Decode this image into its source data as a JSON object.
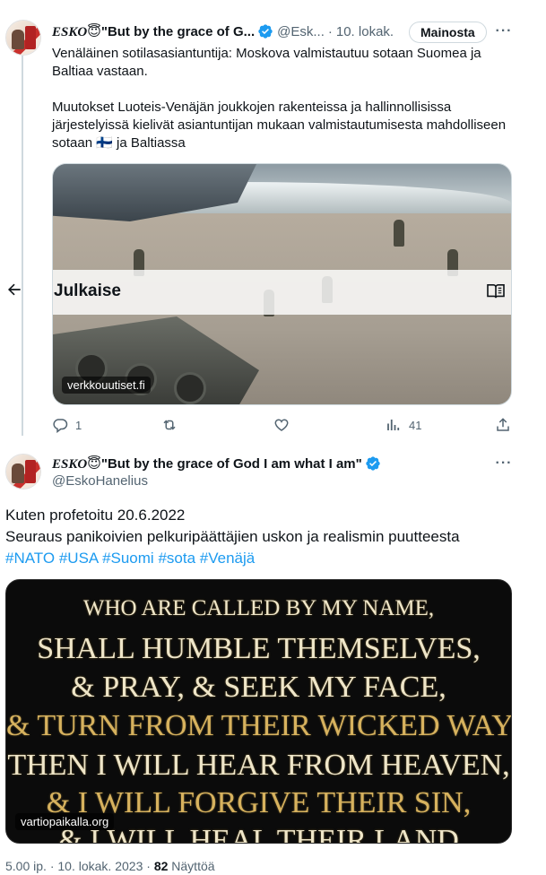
{
  "tweet1": {
    "display_name_prefix": "ESKO",
    "display_name_emoji": "😇",
    "display_name_rest": "\"But by the grace of G...",
    "handle": "@Esk...",
    "separator": "·",
    "date": "10. lokak.",
    "ad_label": "Mainosta",
    "more_label": "···",
    "text_para1": "Venäläinen sotilasasiantuntija: Moskova valmistautuu sotaan Suomea ja Baltiaa vastaan.",
    "text_para2": "Muutokset Luoteis-Venäjän joukkojen rakenteissa ja hallinnollisissa järjestelyissä kielivät asiantuntijan mukaan valmistautumisesta mahdolliseen sotaan 🇫🇮 ja Baltiassa",
    "card_source": "verkkouutiset.fi",
    "actions": {
      "reply_count": "1",
      "retweet_count": "",
      "like_count": "",
      "views_count": "41"
    }
  },
  "publish_bar": {
    "label": "Julkaise",
    "back_icon": "arrow-left-icon",
    "reader_icon": "book-open-icon"
  },
  "tweet2": {
    "display_name_prefix": "ESKO",
    "display_name_emoji": "😇",
    "display_name_rest": "\"But by the grace of God I am what I am\"",
    "handle": "@EskoHanelius",
    "more_label": "···",
    "line1": "Kuten profetoitu 20.6.2022",
    "line2": "Seuraus panikoivien pelkuripäättäjien uskon ja realismin puutteesta",
    "hashtags": [
      "#NATO",
      "#USA",
      "#Suomi",
      "#sota",
      "#Venäjä"
    ],
    "image_source": "vartiopaikalla.org",
    "image_lines": [
      "WHO ARE CALLED BY MY NAME,",
      "SHALL HUMBLE THEMSELVES,",
      "& PRAY, & SEEK MY FACE,",
      "& TURN FROM THEIR WICKED WAYS;",
      "THEN I WILL HEAR FROM HEAVEN,",
      "& I WILL FORGIVE THEIR SIN,",
      "& I WILL HEAL THEIR LAND"
    ]
  },
  "footer": {
    "time": "5.00 ip.",
    "date": "10. lokak. 2023",
    "views_count": "82",
    "views_label": "Näyttöä"
  },
  "colors": {
    "accent": "#1d9bf0",
    "muted": "#536471",
    "verse_gold": "#d7b25e"
  }
}
